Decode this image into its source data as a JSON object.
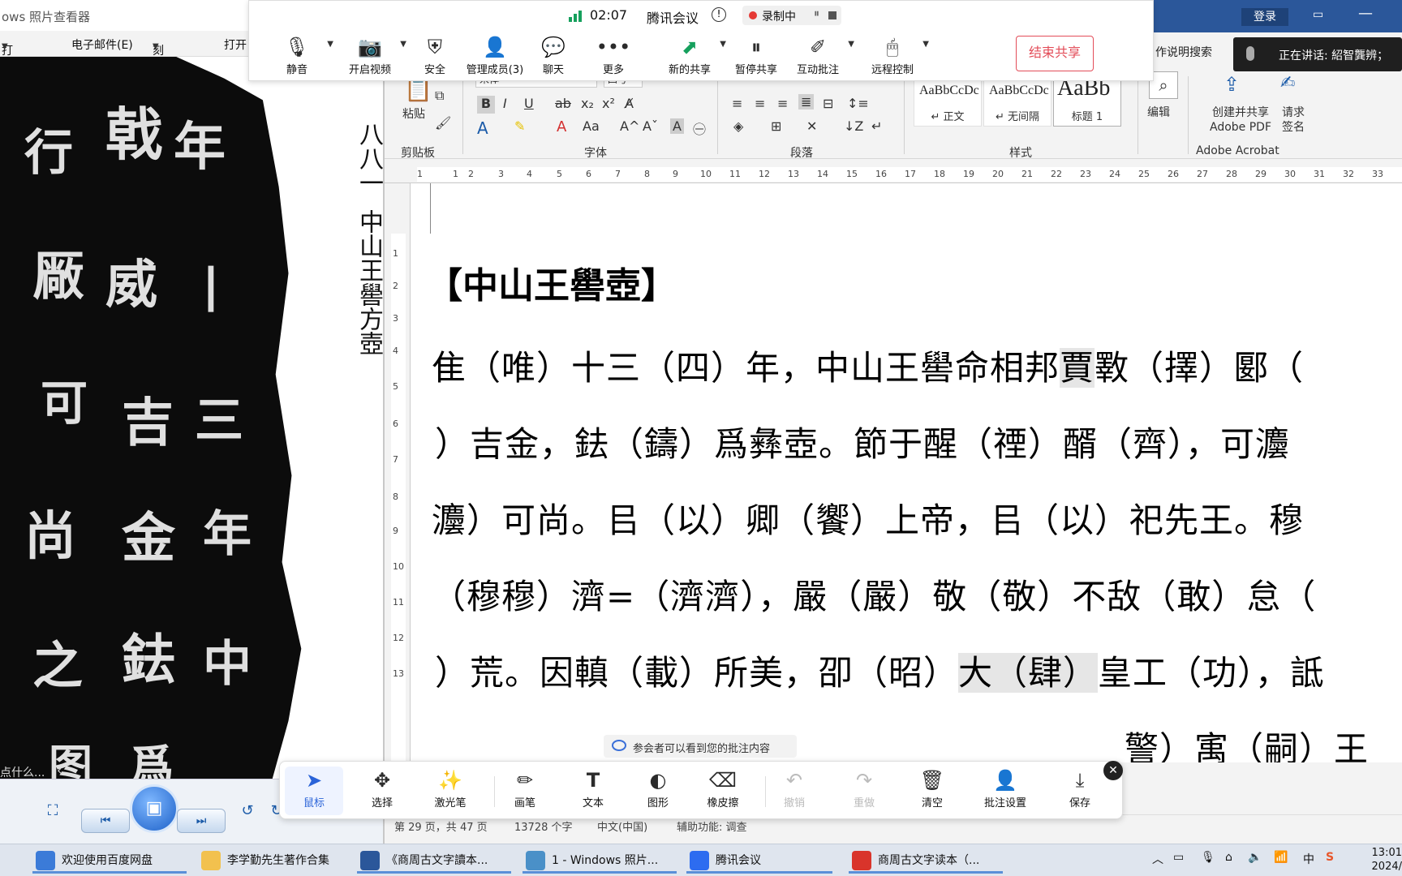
{
  "photo_viewer": {
    "title": "ows 照片查看器",
    "menu": {
      "print": "打印(P)",
      "email": "电子邮件(E)",
      "burn": "刻录(U)",
      "open": "打开"
    },
    "vertical_label_top": "八八一",
    "vertical_label_bottom": "中山王嚳方壺",
    "side_text": "点什么...",
    "side_arrow": "‹"
  },
  "meeting": {
    "time": "02:07",
    "app_name": "腾讯会议",
    "recording_label": "录制中",
    "buttons": {
      "mute": "静音",
      "video": "开启视频",
      "security": "安全",
      "members": "管理成员(3)",
      "chat": "聊天",
      "more": "更多",
      "new_share": "新的共享",
      "pause_share": "暂停共享",
      "annotate": "互动批注",
      "remote": "远程控制",
      "end_share": "结束共享"
    },
    "speaking": "正在讲话: 紹智龔辨；"
  },
  "word": {
    "login": "登录",
    "search_hint": "作说明搜索",
    "ribbon": {
      "paste": "粘贴",
      "clipboard": "剪贴板",
      "font": "字体",
      "paragraph": "段落",
      "styles": "样式",
      "style_items": [
        {
          "sample": "AaBbCcDc",
          "name": "↵ 正文"
        },
        {
          "sample": "AaBbCcDc",
          "name": "↵ 无间隔"
        },
        {
          "sample": "AaBb",
          "name": "标题 1"
        }
      ],
      "edit": "编辑",
      "create_pdf": "创建并共享\nAdobe PDF",
      "create_pdf_l1": "创建并共享",
      "create_pdf_l2": "Adobe PDF",
      "sign_l1": "请求",
      "sign_l2": "签名",
      "acrobat": "Adobe Acrobat",
      "font_name": "宋体",
      "font_size": "四号"
    },
    "document": {
      "title": "【中山王嚳壺】",
      "lines": [
        {
          "pre": "隹（唯）十三（四）年，中山王嚳命相邦",
          "hl": "賈",
          "post": "斁（擇）郾（"
        },
        {
          "pre": "）吉金，鉣（鑄）爲彝壺。節于醒（禋）醑（齊），可灋",
          "hl": "",
          "post": ""
        },
        {
          "pre": "灋）可尚。㠯（以）卿（饗）上帝，㠯（以）祀先王。穆",
          "hl": "",
          "post": ""
        },
        {
          "pre": "（穆穆）濟=（濟濟），嚴（嚴）敬（敬）不敌（敢）怠（",
          "hl": "",
          "post": ""
        },
        {
          "pre": "）荒。因䡩（載）所美，卲（昭）",
          "hl": "大（肆）",
          "post": "皇工（功），詆"
        },
        {
          "pre": "",
          "hl": "",
          "post": "警）㝢（嗣）王"
        }
      ]
    },
    "status": {
      "page": "第 29 页，共 47 页",
      "words": "13728 个字",
      "lang": "中文(中国)",
      "accessibility": "辅助功能: 调查"
    }
  },
  "annotation": {
    "hint": "参会者可以看到您的批注内容",
    "tools": [
      {
        "key": "mouse",
        "label": "鼠标",
        "icon": "cursor-icon",
        "state": "active"
      },
      {
        "key": "select",
        "label": "选择",
        "icon": "move-icon",
        "state": "normal"
      },
      {
        "key": "laser",
        "label": "激光笔",
        "icon": "laser-icon",
        "state": "normal"
      },
      {
        "key": "pen",
        "label": "画笔",
        "icon": "pen-icon",
        "state": "normal"
      },
      {
        "key": "text",
        "label": "文本",
        "icon": "text-icon",
        "state": "normal"
      },
      {
        "key": "shape",
        "label": "图形",
        "icon": "shape-icon",
        "state": "normal"
      },
      {
        "key": "eraser",
        "label": "橡皮擦",
        "icon": "eraser-icon",
        "state": "normal"
      },
      {
        "key": "undo",
        "label": "撤销",
        "icon": "undo-icon",
        "state": "disabled"
      },
      {
        "key": "redo",
        "label": "重做",
        "icon": "redo-icon",
        "state": "disabled"
      },
      {
        "key": "clear",
        "label": "清空",
        "icon": "trash-icon",
        "state": "normal"
      },
      {
        "key": "settings",
        "label": "批注设置",
        "icon": "annotation-settings-icon",
        "state": "normal"
      },
      {
        "key": "save",
        "label": "保存",
        "icon": "download-icon",
        "state": "normal"
      }
    ]
  },
  "taskbar": {
    "items": [
      {
        "label": "欢迎使用百度网盘",
        "color": "#3b7bd8"
      },
      {
        "label": "李学勤先生著作合集",
        "color": "#f2c14e"
      },
      {
        "label": "《商周古文字讀本...",
        "color": "#2b579a"
      },
      {
        "label": "1 - Windows 照片...",
        "color": "#4a90c8"
      },
      {
        "label": "腾讯会议",
        "color": "#2d6cf0"
      },
      {
        "label": "商周古文字读本（...",
        "color": "#d9342b"
      }
    ],
    "tray_ime": "中",
    "clock_time": "13:01",
    "clock_date": "2024/"
  },
  "colors": {
    "word_blue": "#2b579a",
    "meeting_red": "#e34d59",
    "annotation_active": "#2a63d8"
  }
}
